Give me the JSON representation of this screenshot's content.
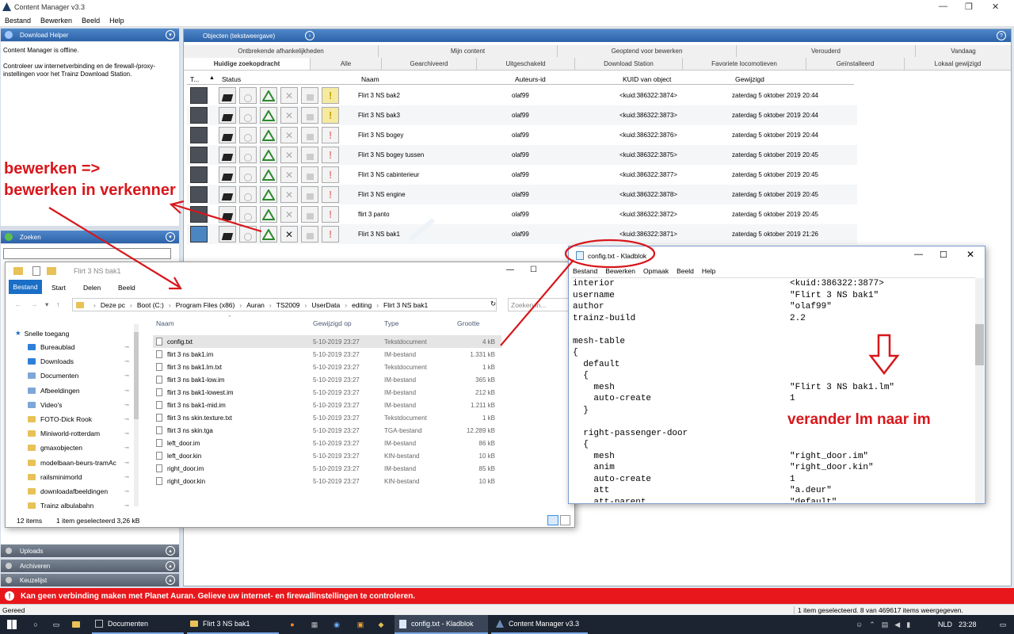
{
  "app": {
    "title": "Content Manager v3.3",
    "menu": [
      "Bestand",
      "Bewerken",
      "Beeld",
      "Help"
    ]
  },
  "left": {
    "download_helper": {
      "title": "Download Helper",
      "line1": "Content Manager is offline.",
      "line2": "Controleer uw internetverbinding en de firewall-/proxy-instellingen voor het Trainz Download Station."
    },
    "zoeken": {
      "title": "Zoeken"
    },
    "bottom_panels": [
      "Uploads",
      "Archiveren",
      "Keuzelijst"
    ]
  },
  "objects": {
    "title": "Objecten (tekstweergave)",
    "tabs_row1": [
      "Ontbrekende afhankelijkheden",
      "Mijn content",
      "Geoptend voor bewerken",
      "Verouderd",
      "Vandaag"
    ],
    "tabs_row2": [
      "Huidige zoekopdracht",
      "Alle",
      "Gearchiveerd",
      "Uitgeschakeld",
      "Download Station",
      "Favoriete locomotieven",
      "Geïnstalleerd",
      "Lokaal gewijzigd"
    ],
    "columns": [
      "T...",
      "Status",
      "Naam",
      "Auteurs-id",
      "KUID van object",
      "Gewijzigd"
    ],
    "rows": [
      {
        "name": "Flirt 3 NS bak2",
        "author": "olaf99",
        "kuid": "<kuid:386322:3874>",
        "date": "zaterdag 5 oktober 2019 20:44"
      },
      {
        "name": "Flirt 3 NS bak3",
        "author": "olaf99",
        "kuid": "<kuid:386322:3873>",
        "date": "zaterdag 5 oktober 2019 20:44"
      },
      {
        "name": "Flirt 3 NS bogey",
        "author": "olaf99",
        "kuid": "<kuid:386322:3876>",
        "date": "zaterdag 5 oktober 2019 20:44"
      },
      {
        "name": "Flirt 3 NS bogey tussen",
        "author": "olaf99",
        "kuid": "<kuid:386322:3875>",
        "date": "zaterdag 5 oktober 2019 20:45"
      },
      {
        "name": "Flirt 3 NS cabinterieur",
        "author": "olaf99",
        "kuid": "<kuid:386322:3877>",
        "date": "zaterdag 5 oktober 2019 20:45"
      },
      {
        "name": "Flirt 3 NS engine",
        "author": "olaf99",
        "kuid": "<kuid:386322:3878>",
        "date": "zaterdag 5 oktober 2019 20:45"
      },
      {
        "name": "flirt 3 panto",
        "author": "olaf99",
        "kuid": "<kuid:386322:3872>",
        "date": "zaterdag 5 oktober 2019 20:45"
      },
      {
        "name": "Flirt 3 NS bak1",
        "author": "olaf99",
        "kuid": "<kuid:386322:3871>",
        "date": "zaterdag 5 oktober 2019 21:26"
      }
    ]
  },
  "annotations": {
    "left1": "bewerken =>",
    "left2": "bewerken in verkenner",
    "right": "verander lm naar im"
  },
  "explorer": {
    "title": "Flirt 3 NS bak1",
    "ribbon": [
      "Bestand",
      "Start",
      "Delen",
      "Beeld"
    ],
    "path": [
      "Deze pc",
      "Boot (C:)",
      "Program Files (x86)",
      "Auran",
      "TS2009",
      "UserData",
      "editing",
      "Flirt 3 NS bak1"
    ],
    "search_placeholder": "Zoeken in...",
    "columns": [
      "Naam",
      "Gewijzigd op",
      "Type",
      "Grootte"
    ],
    "quick_access": "Snelle toegang",
    "nav": [
      "Bureaublad",
      "Downloads",
      "Documenten",
      "Afbeeldingen",
      "Video's",
      "FOTO-Dick Rook",
      "Miniworld-rotterdam",
      "gmaxobjecten",
      "modelbaan-beurs-tramAc",
      "railsminimorld",
      "downloadafbeeldingen",
      "Trainz albulabahn"
    ],
    "files": [
      {
        "name": "config.txt",
        "date": "5-10-2019 23:27",
        "type": "Tekstdocument",
        "size": "4 kB"
      },
      {
        "name": "flirt 3 ns bak1.im",
        "date": "5-10-2019 23:27",
        "type": "IM-bestand",
        "size": "1.331 kB"
      },
      {
        "name": "flirt 3 ns bak1.lm.txt",
        "date": "5-10-2019 23:27",
        "type": "Tekstdocument",
        "size": "1 kB"
      },
      {
        "name": "flirt 3 ns bak1-low.im",
        "date": "5-10-2019 23:27",
        "type": "IM-bestand",
        "size": "365 kB"
      },
      {
        "name": "flirt 3 ns bak1-lowest.im",
        "date": "5-10-2019 23:27",
        "type": "IM-bestand",
        "size": "212 kB"
      },
      {
        "name": "flirt 3 ns bak1-mid.im",
        "date": "5-10-2019 23:27",
        "type": "IM-bestand",
        "size": "1.211 kB"
      },
      {
        "name": "flirt 3 ns skin.texture.txt",
        "date": "5-10-2019 23:27",
        "type": "Tekstdocument",
        "size": "1 kB"
      },
      {
        "name": "flirt 3 ns skin.tga",
        "date": "5-10-2019 23:27",
        "type": "TGA-bestand",
        "size": "12.289 kB"
      },
      {
        "name": "left_door.im",
        "date": "5-10-2019 23:27",
        "type": "IM-bestand",
        "size": "86 kB"
      },
      {
        "name": "left_door.kin",
        "date": "5-10-2019 23:27",
        "type": "KIN-bestand",
        "size": "10 kB"
      },
      {
        "name": "right_door.im",
        "date": "5-10-2019 23:27",
        "type": "IM-bestand",
        "size": "85 kB"
      },
      {
        "name": "right_door.kin",
        "date": "5-10-2019 23:27",
        "type": "KIN-bestand",
        "size": "10 kB"
      }
    ],
    "status_count": "12 items",
    "status_sel": "1 item geselecteerd  3,26 kB"
  },
  "notepad": {
    "title": "config.txt - Kladblok",
    "menu": [
      "Bestand",
      "Bewerken",
      "Opmaak",
      "Beeld",
      "Help"
    ],
    "lines": [
      [
        "interior",
        "<kuid:386322:3877>"
      ],
      [
        "username",
        "\"Flirt 3 NS bak1\""
      ],
      [
        "author",
        "\"olaf99\""
      ],
      [
        "trainz-build",
        "2.2"
      ],
      [
        "",
        ""
      ],
      [
        "mesh-table",
        ""
      ],
      [
        "{",
        ""
      ],
      [
        "  default",
        ""
      ],
      [
        "  {",
        ""
      ],
      [
        "    mesh",
        "\"Flirt 3 NS bak1.lm\""
      ],
      [
        "    auto-create",
        "1"
      ],
      [
        "  }",
        ""
      ],
      [
        "",
        ""
      ],
      [
        "  right-passenger-door",
        ""
      ],
      [
        "  {",
        ""
      ],
      [
        "    mesh",
        "\"right_door.im\""
      ],
      [
        "    anim",
        "\"right_door.kin\""
      ],
      [
        "    auto-create",
        "1"
      ],
      [
        "    att",
        "\"a.deur\""
      ],
      [
        "    att-parent",
        "\"default\""
      ]
    ]
  },
  "error_bar": "Kan geen verbinding maken met Planet Auran. Gelieve uw internet- en firewallinstellingen te controleren.",
  "statusbar": {
    "left": "Gereed",
    "right": "1 item geselecteerd. 8 van 469617 items weergegeven."
  },
  "taskbar": {
    "items": [
      "Documenten",
      "Flirt 3 NS bak1",
      "config.txt - Kladblok",
      "Content Manager v3.3"
    ],
    "lang": "NLD",
    "time": "23:28"
  },
  "colors": {
    "accent": "#2c62a8",
    "annotation": "#d8161b",
    "error": "#e8171b"
  }
}
